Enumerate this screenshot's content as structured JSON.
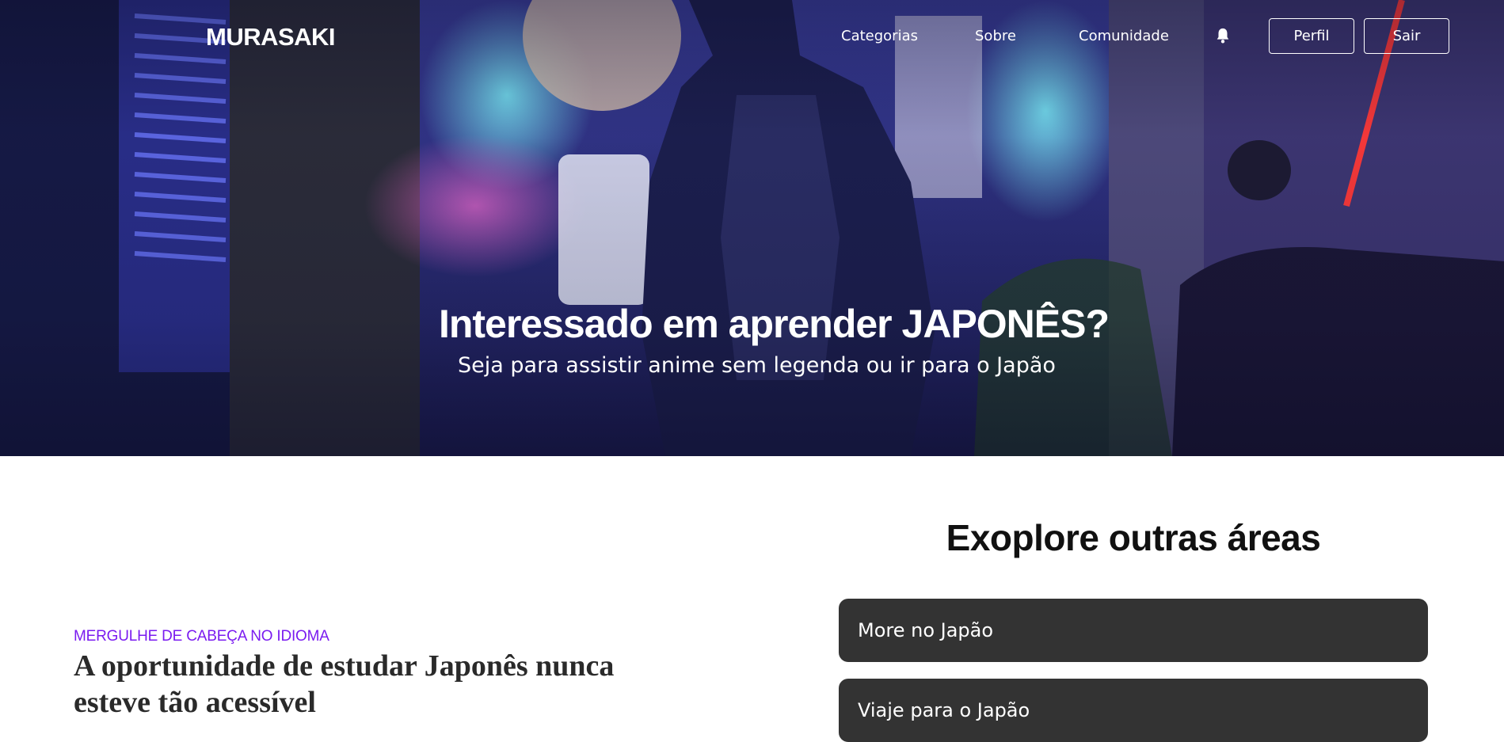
{
  "header": {
    "logo": "MURASAKI",
    "nav_links": [
      "Categorias",
      "Sobre",
      "Comunidade"
    ],
    "bell_icon": "bell-icon",
    "profile_label": "Perfil",
    "logout_label": "Sair"
  },
  "hero": {
    "title": "Interessado em aprender JAPONÊS?",
    "subtitle": "Seja para assistir anime sem legenda ou ir para o Japão"
  },
  "feature": {
    "eyebrow": "MERGULHE DE CABEÇA NO IDIOMA",
    "title": "A oportunidade de estudar Japonês nunca esteve tão acessível"
  },
  "explore": {
    "heading": "Exoplore outras áreas",
    "items": [
      "More no Japão",
      "Viaje para o Japão"
    ]
  },
  "colors": {
    "accent": "#7a1bf0",
    "card_bg": "#333333",
    "hero_tone": "#2a2f74"
  }
}
